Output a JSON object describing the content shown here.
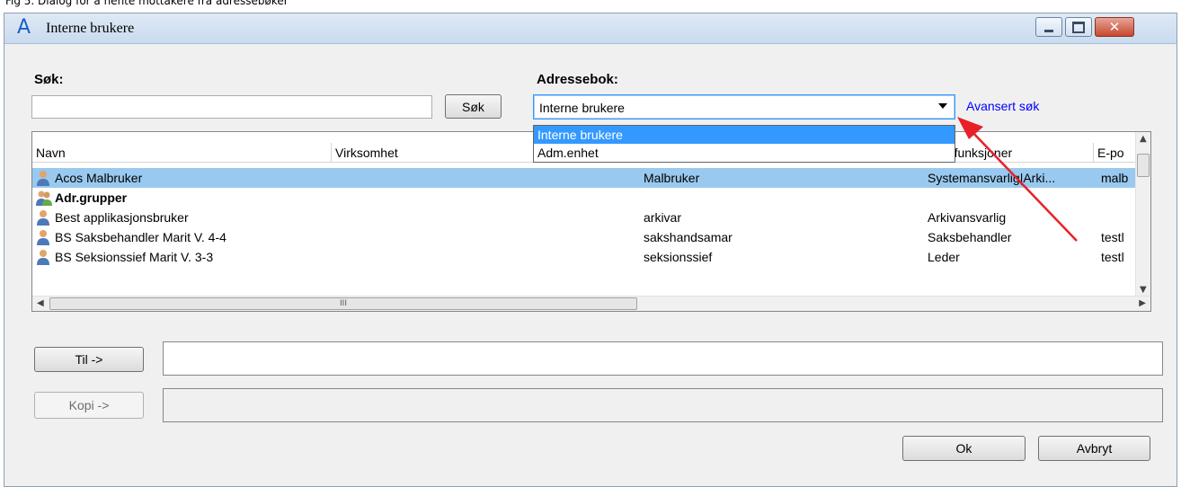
{
  "window": {
    "top_strip_text": "Fig 5. Dialog for å hente mottakere fra adressebøker",
    "title": "Interne brukere",
    "app_icon_glyph": "A"
  },
  "search": {
    "label": "Søk:",
    "value": "",
    "button": "Søk"
  },
  "addressbook": {
    "label": "Adressebok:",
    "selected": "Interne brukere",
    "options": [
      "Interne brukere",
      "Adm.enhet"
    ],
    "advanced_link": "Avansert søk"
  },
  "list": {
    "columns": [
      "Navn",
      "Virksomhet",
      "ngsfunksjoner",
      "E-po"
    ],
    "rows": [
      {
        "name": "Acos Malbruker",
        "role": "Malbruker",
        "function": "Systemansvarlig|Arki...",
        "email": "malb",
        "selected": true,
        "bold": false,
        "icon": "user-icon"
      },
      {
        "name": "Adr.grupper",
        "role": "",
        "function": "",
        "email": "",
        "selected": false,
        "bold": true,
        "icon": "group-icon"
      },
      {
        "name": "Best applikasjonsbruker",
        "role": "arkivar",
        "function": "Arkivansvarlig",
        "email": "",
        "selected": false,
        "bold": false,
        "icon": "user-icon"
      },
      {
        "name": "BS Saksbehandler Marit V.  4-4",
        "role": "sakshandsamar",
        "function": "Saksbehandler",
        "email": "testl",
        "selected": false,
        "bold": false,
        "icon": "user-icon"
      },
      {
        "name": "BS Seksionssief  Marit V.  3-3",
        "role": "seksionssief",
        "function": "Leder",
        "email": "testl",
        "selected": false,
        "bold": false,
        "icon": "user-icon"
      }
    ],
    "hscroll_grip": "III"
  },
  "recipients": {
    "to_button": "Til ->",
    "to_value": "",
    "copy_button": "Kopi ->",
    "copy_value": ""
  },
  "footer": {
    "ok": "Ok",
    "cancel": "Avbryt"
  },
  "colors": {
    "selection": "#99c9ef",
    "dropdown_highlight": "#3399ff",
    "link": "#0000ff",
    "annotation_arrow": "#e8202a"
  }
}
